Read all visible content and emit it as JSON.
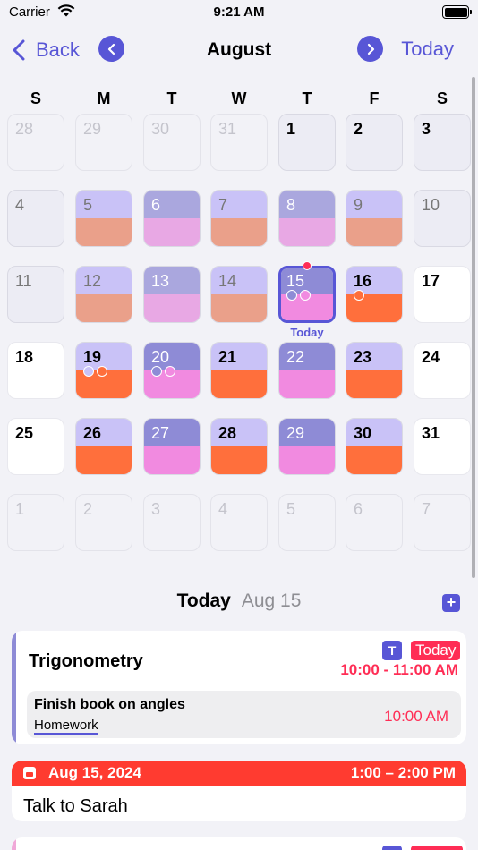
{
  "status_bar": {
    "carrier": "Carrier",
    "time": "9:21 AM"
  },
  "nav": {
    "back_label": "Back",
    "title": "August",
    "today_label": "Today"
  },
  "weekdays": [
    "S",
    "M",
    "T",
    "W",
    "T",
    "F",
    "S"
  ],
  "colors": {
    "accent": "#5856d6",
    "lavender": "#c9c2f7",
    "periwinkle": "#8e8bd6",
    "salmon": "#eaa08a",
    "pink_light": "#e8a8e4",
    "orange": "#ff6f3c",
    "pink": "#f18ae0",
    "red": "#ff3b30"
  },
  "calendar": {
    "days": [
      {
        "num": "28",
        "style": "other"
      },
      {
        "num": "29",
        "style": "other"
      },
      {
        "num": "30",
        "style": "other"
      },
      {
        "num": "31",
        "style": "other"
      },
      {
        "num": "1",
        "style": "plain"
      },
      {
        "num": "2",
        "style": "plain"
      },
      {
        "num": "3",
        "style": "plain"
      },
      {
        "num": "4",
        "style": "plain"
      },
      {
        "num": "5",
        "style": "split",
        "top": "#c9c2f7",
        "bot": "#eaa08a"
      },
      {
        "num": "6",
        "style": "split",
        "top": "#aaa7de",
        "bot": "#e8a8e4",
        "light": true
      },
      {
        "num": "7",
        "style": "split",
        "top": "#c9c2f7",
        "bot": "#eaa08a"
      },
      {
        "num": "8",
        "style": "split",
        "top": "#aaa7de",
        "bot": "#e8a8e4",
        "light": true
      },
      {
        "num": "9",
        "style": "split",
        "top": "#c9c2f7",
        "bot": "#eaa08a"
      },
      {
        "num": "10",
        "style": "plain"
      },
      {
        "num": "11",
        "style": "plain"
      },
      {
        "num": "12",
        "style": "split",
        "top": "#c9c2f7",
        "bot": "#eaa08a"
      },
      {
        "num": "13",
        "style": "split",
        "top": "#aaa7de",
        "bot": "#e8a8e4",
        "light": true
      },
      {
        "num": "14",
        "style": "split",
        "top": "#c9c2f7",
        "bot": "#eaa08a"
      },
      {
        "num": "15",
        "style": "split",
        "top": "#8e8bd6",
        "bot": "#f18ae0",
        "selected": true,
        "light": true,
        "dots": [
          "#8e8bd6",
          "#f18ae0"
        ],
        "label": "Today"
      },
      {
        "num": "16",
        "style": "split",
        "top": "#c9c2f7",
        "bot": "#ff6f3c",
        "bold": true,
        "dots": [
          "#ff6f3c"
        ]
      },
      {
        "num": "17",
        "style": "white"
      },
      {
        "num": "18",
        "style": "white"
      },
      {
        "num": "19",
        "style": "split",
        "top": "#c9c2f7",
        "bot": "#ff6f3c",
        "bold": true,
        "dots": [
          "#c9c2f7",
          "#ff6f3c"
        ]
      },
      {
        "num": "20",
        "style": "split",
        "top": "#8e8bd6",
        "bot": "#f18ae0",
        "light": true,
        "dots": [
          "#8e8bd6",
          "#f18ae0"
        ]
      },
      {
        "num": "21",
        "style": "split",
        "top": "#c9c2f7",
        "bot": "#ff6f3c",
        "bold": true
      },
      {
        "num": "22",
        "style": "split",
        "top": "#8e8bd6",
        "bot": "#f18ae0",
        "light": true
      },
      {
        "num": "23",
        "style": "split",
        "top": "#c9c2f7",
        "bot": "#ff6f3c",
        "bold": true
      },
      {
        "num": "24",
        "style": "white"
      },
      {
        "num": "25",
        "style": "white"
      },
      {
        "num": "26",
        "style": "split",
        "top": "#c9c2f7",
        "bot": "#ff6f3c",
        "bold": true
      },
      {
        "num": "27",
        "style": "split",
        "top": "#8e8bd6",
        "bot": "#f18ae0",
        "light": true
      },
      {
        "num": "28",
        "style": "split",
        "top": "#c9c2f7",
        "bot": "#ff6f3c",
        "bold": true
      },
      {
        "num": "29",
        "style": "split",
        "top": "#8e8bd6",
        "bot": "#f18ae0",
        "light": true
      },
      {
        "num": "30",
        "style": "split",
        "top": "#c9c2f7",
        "bot": "#ff6f3c",
        "bold": true
      },
      {
        "num": "31",
        "style": "white"
      },
      {
        "num": "1",
        "style": "other"
      },
      {
        "num": "2",
        "style": "other"
      },
      {
        "num": "3",
        "style": "other"
      },
      {
        "num": "4",
        "style": "other"
      },
      {
        "num": "5",
        "style": "other"
      },
      {
        "num": "6",
        "style": "other"
      },
      {
        "num": "7",
        "style": "other"
      }
    ]
  },
  "day_header": {
    "label": "Today",
    "date": "Aug 15",
    "add_symbol": "+"
  },
  "events": [
    {
      "title": "Trigonometry",
      "badge_letter": "T",
      "badge_today": "Today",
      "time": "10:00 - 11:00 AM",
      "subtask": {
        "title": "Finish book on angles",
        "tag": "Homework",
        "time": "10:00 AM"
      }
    },
    {
      "date": "Aug 15, 2024",
      "time": "1:00 – 2:00 PM",
      "title": "Talk to Sarah"
    }
  ]
}
